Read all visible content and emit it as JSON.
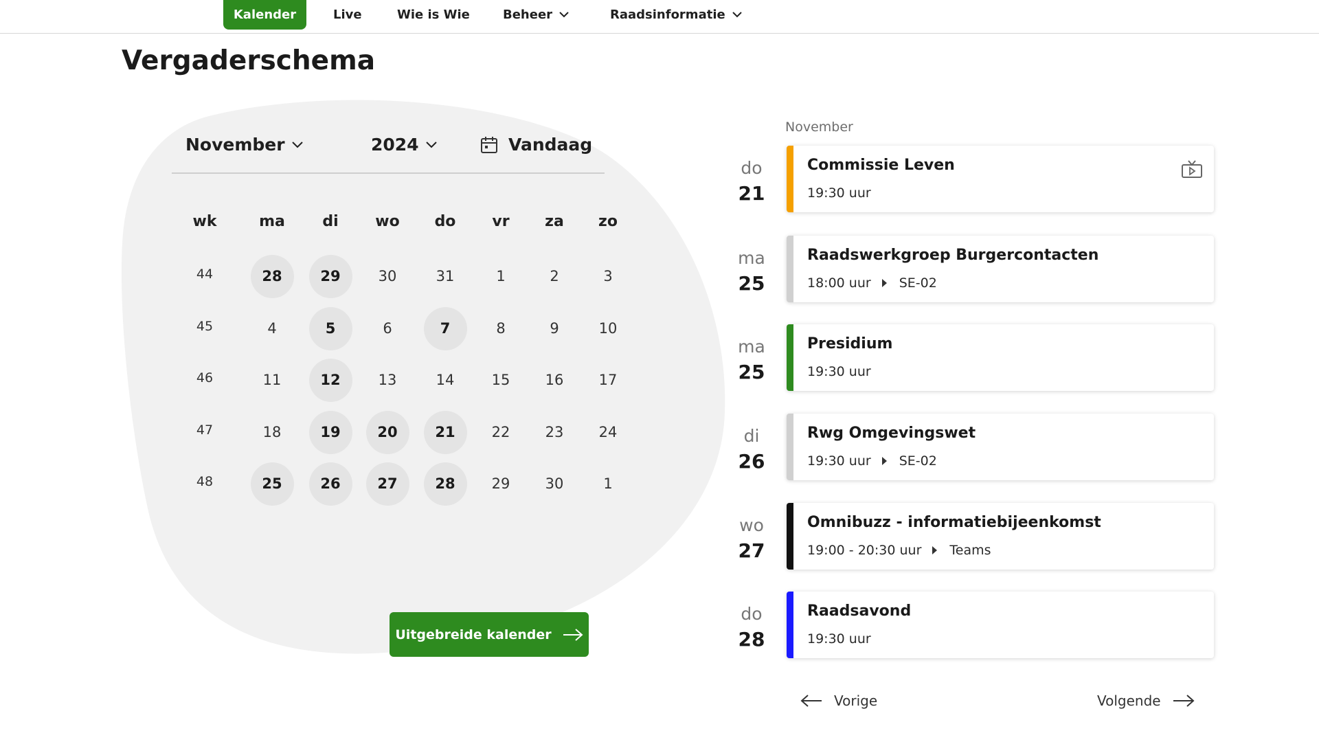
{
  "nav": {
    "items": [
      {
        "label": "Kalender",
        "active": true,
        "dropdown": false
      },
      {
        "label": "Live",
        "active": false,
        "dropdown": false
      },
      {
        "label": "Wie is Wie",
        "active": false,
        "dropdown": false
      },
      {
        "label": "Beheer",
        "active": false,
        "dropdown": true
      },
      {
        "label": "Raadsinformatie",
        "active": false,
        "dropdown": true
      }
    ]
  },
  "page": {
    "title": "Vergaderschema"
  },
  "calendar": {
    "month": "November",
    "year": "2024",
    "today_label": "Vandaag",
    "headers": [
      "wk",
      "ma",
      "di",
      "wo",
      "do",
      "vr",
      "za",
      "zo"
    ],
    "weeks": [
      {
        "wk": "44",
        "days": [
          {
            "d": "28",
            "e": true
          },
          {
            "d": "29",
            "e": true
          },
          {
            "d": "30",
            "e": false
          },
          {
            "d": "31",
            "e": false
          },
          {
            "d": "1",
            "e": false
          },
          {
            "d": "2",
            "e": false
          },
          {
            "d": "3",
            "e": false
          }
        ]
      },
      {
        "wk": "45",
        "days": [
          {
            "d": "4",
            "e": false
          },
          {
            "d": "5",
            "e": true
          },
          {
            "d": "6",
            "e": false
          },
          {
            "d": "7",
            "e": true
          },
          {
            "d": "8",
            "e": false
          },
          {
            "d": "9",
            "e": false
          },
          {
            "d": "10",
            "e": false
          }
        ]
      },
      {
        "wk": "46",
        "days": [
          {
            "d": "11",
            "e": false
          },
          {
            "d": "12",
            "e": true
          },
          {
            "d": "13",
            "e": false
          },
          {
            "d": "14",
            "e": false
          },
          {
            "d": "15",
            "e": false
          },
          {
            "d": "16",
            "e": false
          },
          {
            "d": "17",
            "e": false
          }
        ]
      },
      {
        "wk": "47",
        "days": [
          {
            "d": "18",
            "e": false
          },
          {
            "d": "19",
            "e": true
          },
          {
            "d": "20",
            "e": true
          },
          {
            "d": "21",
            "e": true
          },
          {
            "d": "22",
            "e": false
          },
          {
            "d": "23",
            "e": false
          },
          {
            "d": "24",
            "e": false
          }
        ]
      },
      {
        "wk": "48",
        "days": [
          {
            "d": "25",
            "e": true
          },
          {
            "d": "26",
            "e": true
          },
          {
            "d": "27",
            "e": true
          },
          {
            "d": "28",
            "e": true
          },
          {
            "d": "29",
            "e": false
          },
          {
            "d": "30",
            "e": false
          },
          {
            "d": "1",
            "e": false
          }
        ]
      }
    ],
    "extended_button": "Uitgebreide kalender"
  },
  "events": {
    "month_label": "November",
    "items": [
      {
        "dow": "do",
        "day": "21",
        "title": "Commissie Leven",
        "time": "19:30 uur",
        "location": "",
        "color": "#f5a000",
        "live_icon": "broadcast-tv-icon"
      },
      {
        "dow": "ma",
        "day": "25",
        "title": "Raadswerkgroep Burgercontacten",
        "time": "18:00 uur",
        "location": "SE-02",
        "color": "#d0d0d0",
        "live_icon": ""
      },
      {
        "dow": "ma",
        "day": "25",
        "title": "Presidium",
        "time": "19:30 uur",
        "location": "",
        "color": "#2e8b1f",
        "live_icon": ""
      },
      {
        "dow": "di",
        "day": "26",
        "title": "Rwg Omgevingswet",
        "time": "19:30 uur",
        "location": "SE-02",
        "color": "#d0d0d0",
        "live_icon": ""
      },
      {
        "dow": "wo",
        "day": "27",
        "title": "Omnibuzz - informatiebijeenkomst",
        "time": "19:00 - 20:30 uur",
        "location": "Teams",
        "color": "#111111",
        "live_icon": ""
      },
      {
        "dow": "do",
        "day": "28",
        "title": "Raadsavond",
        "time": "19:30 uur",
        "location": "",
        "color": "#1a1aff",
        "live_icon": ""
      }
    ]
  },
  "pager": {
    "prev": "Vorige",
    "next": "Volgende"
  },
  "colors": {
    "accent": "#2e8b1f",
    "blob": "#f1f1f1"
  }
}
